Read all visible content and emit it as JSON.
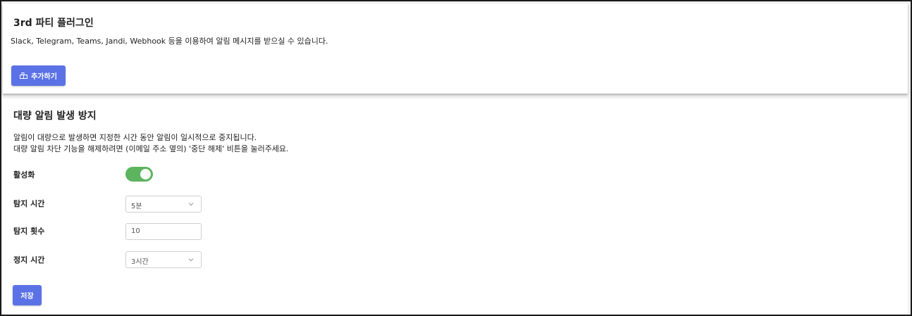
{
  "plugin_section": {
    "title": "3rd 파티 플러그인",
    "description": "Slack, Telegram, Teams, Jandi, Webhook 등을 이용하여 알림 메시지를 받으실 수 있습니다.",
    "add_button": {
      "label": "추가하기",
      "icon": "plugin-add-icon"
    }
  },
  "flood_section": {
    "title": "대량 알림 발생 방지",
    "description_lines": [
      "알림이 대량으로 발생하면 지정한 시간 동안 알림이 일시적으로 중지됩니다.",
      "대량 알림 차단 기능을 해제하려면 (이메일 주소 옆의) '중단 해제' 비튼을 눌러주세요."
    ],
    "fields": {
      "enabled": {
        "label": "활성화",
        "value": true,
        "on_color": "#5cb45f"
      },
      "detect_time": {
        "label": "탐지 시간",
        "value": "5분",
        "icon": "chevron-down-icon"
      },
      "detect_count": {
        "label": "탐지 횟수",
        "value": "10"
      },
      "stop_time": {
        "label": "정지 시간",
        "value": "3시간",
        "icon": "chevron-down-icon"
      }
    },
    "save_button": {
      "label": "저장"
    }
  },
  "colors": {
    "accent": "#5b72e6",
    "toggle_on": "#5cb45f",
    "background": "#f1f1f1"
  }
}
